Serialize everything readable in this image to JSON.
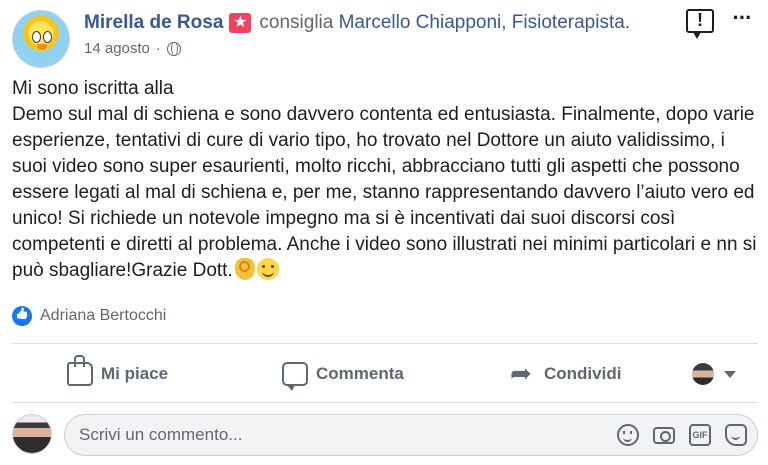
{
  "post": {
    "author": "Mirella de Rosa",
    "recommendation_text": "consiglia",
    "recommended_page": "Marcello Chiapponi, Fisioterapista.",
    "date": "14 agosto",
    "date_separator": "·",
    "audience_icon": "globe-icon",
    "body": "Mi sono iscritta alla\nDemo sul mal di schiena e sono davvero contenta ed entusiasta. Finalmente, dopo varie esperienze, tentativi di cure di vario tipo, ho trovato nel Dottore un aiuto validissimo, i suoi video sono super esaurienti, molto ricchi, abbracciano tutti gli aspetti che possono essere legati al mal di schiena e, per me, stanno rappresentando davvero l’aiuto vero ed unico! Si richiede un notevole impegno ma si è incentivati dai suoi discorsi così competenti e diretti al problema. Anche i video sono illustrati nei minimi particolari e nn si può sbagliare!Grazie Dott.",
    "emojis": [
      "ok-hand-emoji",
      "smiling-face-emoji"
    ]
  },
  "reactions": {
    "liked_by": "Adriana Bertocchi"
  },
  "actions": {
    "like_label": "Mi piace",
    "comment_label": "Commenta",
    "share_label": "Condividi"
  },
  "composer": {
    "placeholder": "Scrivi un commento...",
    "icons": [
      "emoji-icon",
      "camera-icon",
      "gif-icon",
      "sticker-icon"
    ],
    "gif_text": "GIF"
  },
  "colors": {
    "link": "#385898",
    "secondary_text": "#616770",
    "like_blue": "#1877f2",
    "recommend_badge": "#f3425f"
  }
}
